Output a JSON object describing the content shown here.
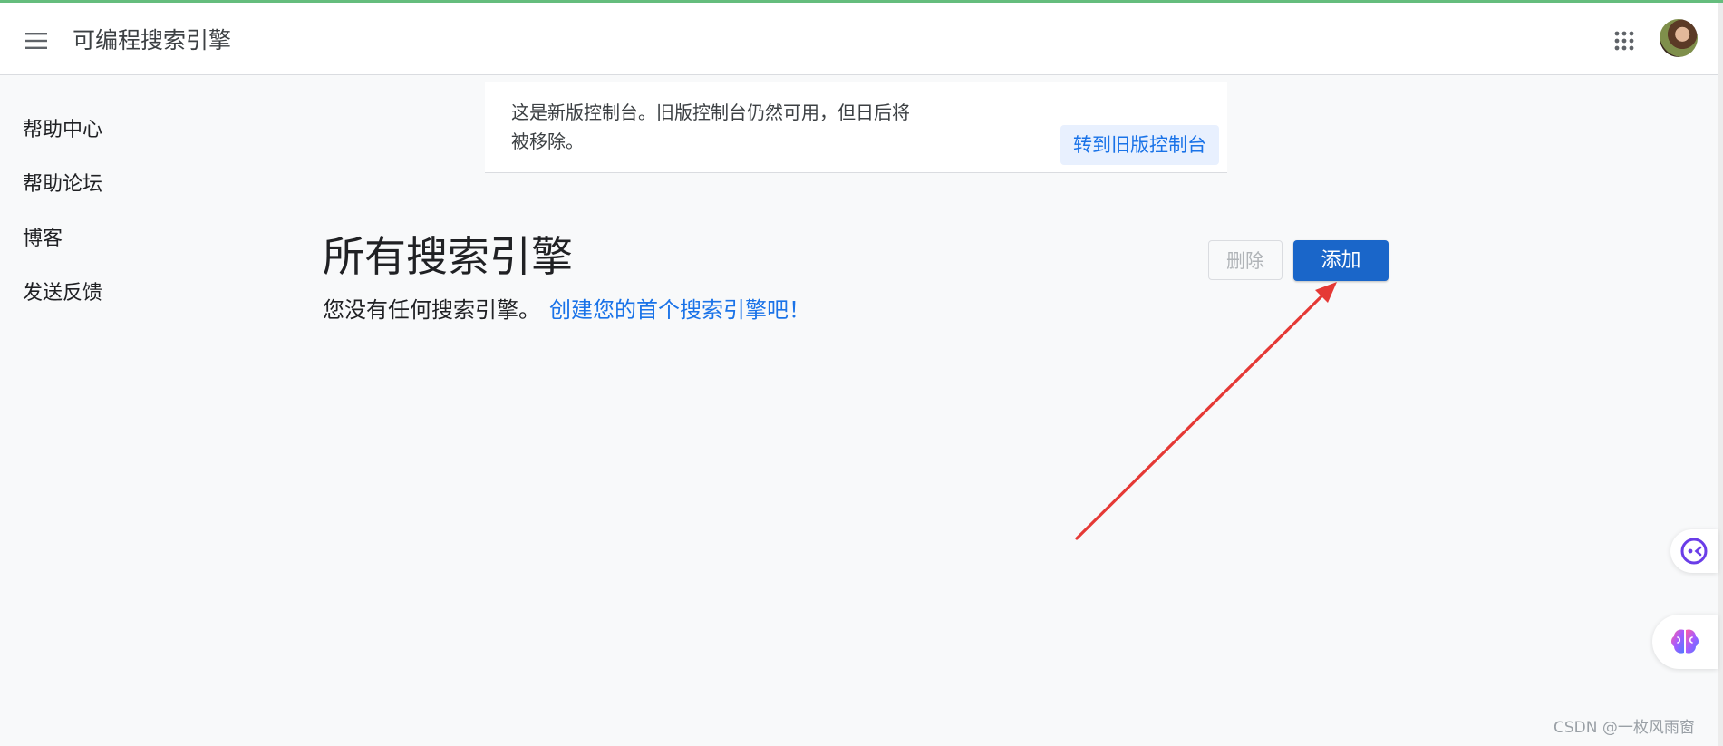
{
  "header": {
    "app_title": "可编程搜索引擎",
    "menu_icon": "hamburger-menu-icon",
    "apps_icon": "apps-grid-icon",
    "avatar_icon": "user-avatar"
  },
  "sidebar": {
    "items": [
      {
        "label": "帮助中心"
      },
      {
        "label": "帮助论坛"
      },
      {
        "label": "博客"
      },
      {
        "label": "发送反馈"
      }
    ]
  },
  "notice": {
    "line1": "这是新版控制台。旧版控制台仍然可用，但日后将",
    "line2": "被移除。",
    "legacy_button": "转到旧版控制台"
  },
  "main": {
    "title": "所有搜索引擎",
    "empty_message": "您没有任何搜索引擎。",
    "create_link": "创建您的首个搜索引擎吧！",
    "delete_button": "删除",
    "add_button": "添加"
  },
  "floating": {
    "assistant_icon": "chat-assistant-icon",
    "brain_icon": "ai-brain-icon"
  },
  "watermark": "CSDN @一枚风雨窗",
  "colors": {
    "primary": "#1a66c9",
    "link": "#1a73e8",
    "annotation": "#e53935",
    "background": "#f8f9fa"
  }
}
